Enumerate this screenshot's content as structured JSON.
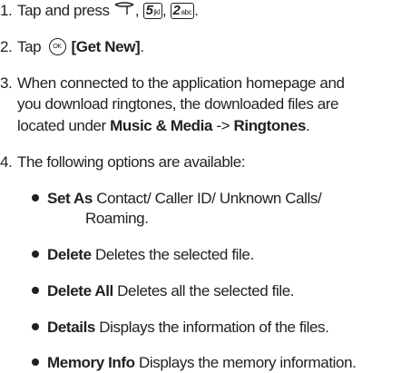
{
  "steps": [
    {
      "number": "1.",
      "text": "Tap and press",
      "keys": {
        "comma1": ",",
        "key5_digit": "5",
        "key5_letters": "jkl",
        "comma2": ",",
        "key2_digit": "2",
        "key2_letters": "abc",
        "end": "."
      }
    },
    {
      "number": "2.",
      "text": "Tap",
      "ok_key": "OK",
      "bold": "[Get New]",
      "end": "."
    },
    {
      "number": "3.",
      "line1": "When connected to the application homepage and",
      "line2": "you download ringtones, the downloaded files are",
      "line3_pre": "located under",
      "bold1": "Music & Media",
      "arrow": "->",
      "bold2": "Ringtones",
      "end": "."
    },
    {
      "number": "4.",
      "text": "The following options are available:"
    }
  ],
  "options": [
    {
      "name": "Set As",
      "desc": "Contact/ Caller ID/ Unknown Calls/",
      "desc2": "Roaming."
    },
    {
      "name": "Delete",
      "desc": "Deletes the selected file."
    },
    {
      "name": "Delete All",
      "desc": "Deletes all the selected file."
    },
    {
      "name": "Details",
      "desc": "Displays the information of the files."
    },
    {
      "name": "Memory Info",
      "desc": "Displays the memory information."
    }
  ]
}
